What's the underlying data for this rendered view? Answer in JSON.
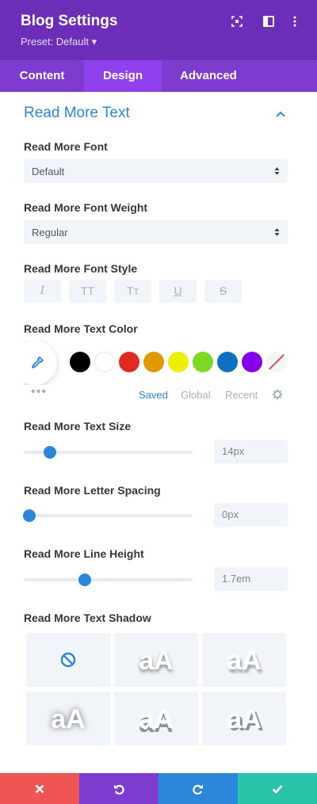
{
  "header": {
    "title": "Blog Settings",
    "preset": "Preset: Default ▾",
    "icons": [
      "fullscreen-icon",
      "sidebar-layout-icon",
      "more-vertical-icon"
    ]
  },
  "tabs": [
    {
      "label": "Content",
      "active": false
    },
    {
      "label": "Design",
      "active": true
    },
    {
      "label": "Advanced",
      "active": false
    }
  ],
  "section": {
    "title": "Read More Text",
    "collapse_icon": "chevron-up-icon"
  },
  "font": {
    "label": "Read More Font",
    "value": "Default"
  },
  "font_weight": {
    "label": "Read More Font Weight",
    "value": "Regular"
  },
  "font_style": {
    "label": "Read More Font Style",
    "buttons": [
      {
        "glyph": "I",
        "name": "italic"
      },
      {
        "glyph": "TT",
        "name": "uppercase"
      },
      {
        "glyph": "Tт",
        "name": "capitalize"
      },
      {
        "glyph": "U",
        "name": "underline"
      },
      {
        "glyph": "S",
        "name": "strikethrough"
      }
    ]
  },
  "text_color": {
    "label": "Read More Text Color",
    "picker_icon": "eyedropper-icon",
    "swatches": [
      "#000000",
      "#ffffff",
      "#e02b20",
      "#e09900",
      "#edf000",
      "#7cda24",
      "#0c71c3",
      "#8300e9",
      "none"
    ],
    "more": "•••",
    "tabs": [
      {
        "label": "Saved",
        "active": true
      },
      {
        "label": "Global",
        "active": false
      },
      {
        "label": "Recent",
        "active": false
      }
    ],
    "settings_icon": "gear-icon"
  },
  "text_size": {
    "label": "Read More Text Size",
    "value": "14px",
    "slider_fraction": 0.155
  },
  "letter_spacing": {
    "label": "Read More Letter Spacing",
    "value": "0px",
    "slider_fraction": 0.035
  },
  "line_height": {
    "label": "Read More Line Height",
    "value": "1.7em",
    "slider_fraction": 0.36
  },
  "text_shadow": {
    "label": "Read More Text Shadow",
    "none_icon": "no-shadow-icon",
    "preview_text": "aA"
  },
  "footer": {
    "buttons": [
      {
        "name": "discard-button",
        "icon": "close-icon",
        "color": "#ef5555"
      },
      {
        "name": "undo-button",
        "icon": "undo-icon",
        "color": "#7e3bd0"
      },
      {
        "name": "redo-button",
        "icon": "redo-icon",
        "color": "#2b87da"
      },
      {
        "name": "save-button",
        "icon": "check-icon",
        "color": "#29c4a9"
      }
    ]
  },
  "colors": {
    "header_bg": "#6c2eb9",
    "tabs_bg": "#7e3bd0",
    "active_tab_bg": "#8f42ec",
    "accent": "#2b87da"
  }
}
